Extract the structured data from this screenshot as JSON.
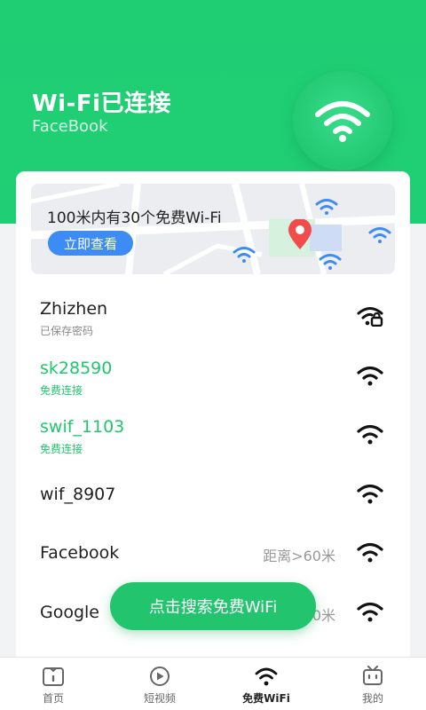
{
  "header": {
    "title": "Wi-Fi已连接",
    "subtitle": "FaceBook",
    "hero_icon": "wifi-icon",
    "accent": "#20cf75"
  },
  "map": {
    "text": "100米内有30个免费Wi-Fi",
    "button": "立即查看",
    "button_color": "#3d8bf4",
    "icons": [
      "wifi-icon",
      "location-pin-icon"
    ]
  },
  "networks": [
    {
      "name": "Zhizhen",
      "sub": "已保存密码",
      "dist": "",
      "icon": "wifi-lock-icon",
      "green": false
    },
    {
      "name": "sk28590",
      "sub": "免费连接",
      "dist": "",
      "icon": "wifi-icon",
      "green": true
    },
    {
      "name": "swif_1103",
      "sub": "免费连接",
      "dist": "",
      "icon": "wifi-icon",
      "green": true
    },
    {
      "name": "wif_8907",
      "sub": "",
      "dist": "",
      "icon": "wifi-icon",
      "green": false
    },
    {
      "name": "Facebook",
      "sub": "",
      "dist": "距离>60米",
      "icon": "wifi-icon",
      "green": false
    },
    {
      "name": "Google",
      "sub": "",
      "dist": "0米",
      "icon": "wifi-icon",
      "green": false
    }
  ],
  "cta": {
    "label": "点击搜索免费WiFi"
  },
  "tabbar": {
    "tabs": [
      {
        "label": "首页",
        "icon": "home-icon"
      },
      {
        "label": "短视频",
        "icon": "play-icon"
      },
      {
        "label": "免费WiFi",
        "icon": "wifi-icon"
      },
      {
        "label": "我的",
        "icon": "tv-icon"
      }
    ],
    "active": 2
  }
}
